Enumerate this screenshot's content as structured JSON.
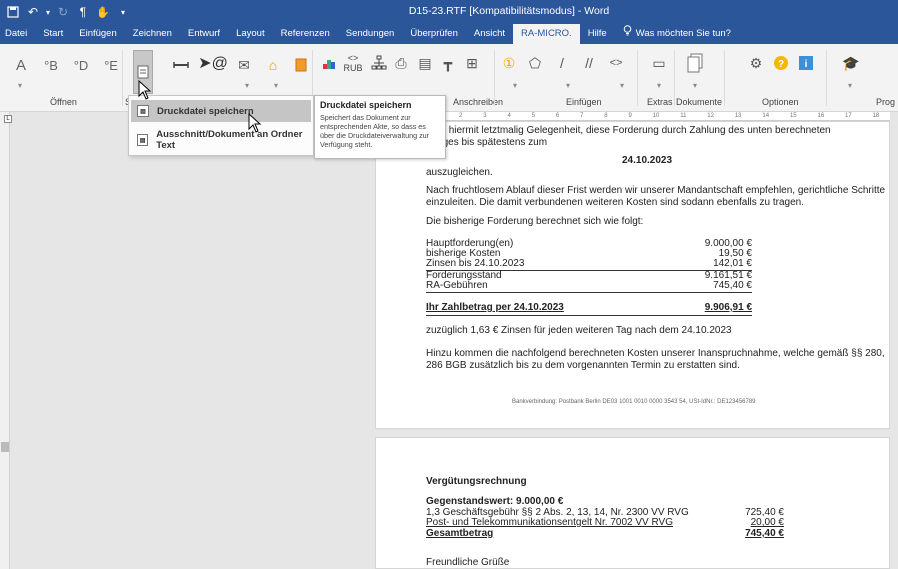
{
  "window": {
    "title": "D15-23.RTF [Kompatibilitätsmodus] - Word"
  },
  "tabs": [
    {
      "label": "Datei"
    },
    {
      "label": "Start"
    },
    {
      "label": "Einfügen"
    },
    {
      "label": "Zeichnen"
    },
    {
      "label": "Entwurf"
    },
    {
      "label": "Layout"
    },
    {
      "label": "Referenzen"
    },
    {
      "label": "Sendungen"
    },
    {
      "label": "Überprüfen"
    },
    {
      "label": "Ansicht"
    },
    {
      "label": "RA-MICRO."
    },
    {
      "label": "Hilfe"
    },
    {
      "label": "Was möchten Sie tun?"
    }
  ],
  "ribbon": {
    "groups": {
      "oeffnen": "Öffnen",
      "s": "S",
      "anschreiben": "Anschreiben",
      "einfuegen": "Einfügen",
      "extras": "Extras",
      "dokumente": "Dokumente",
      "optionen": "Optionen",
      "prog": "Prog"
    },
    "icon_labels": {
      "a": "A",
      "b": "°B",
      "d": "°D",
      "e": "°E",
      "rub": "RUB"
    }
  },
  "menu": {
    "items": [
      {
        "label": "Druckdatei speichern"
      },
      {
        "label": "Ausschnitt/Dokument an Ordner Text"
      }
    ]
  },
  "tooltip": {
    "title": "Druckdatei speichern",
    "body": "Speichert das Dokument zur entsprechenden Akte, so dass es über die Druckdateiverwaltung zur Verfügung steht."
  },
  "page1": {
    "line1": "r geben hiermit letztmalig Gelegenheit, diese Forderung durch Zahlung des unten berechneten",
    "line2": "hlbetrages bis spätestens zum",
    "date": "24.10.2023",
    "auszugleichen": "auszugleichen.",
    "para2": "Nach fruchtlosem Ablauf dieser Frist werden wir unserer Mandantschaft empfehlen, gerichtliche Schritte einzuleiten. Die damit verbundenen weiteren Kosten sind sodann ebenfalls zu tragen.",
    "para3": "Die bisherige Forderung berechnet sich wie folgt:",
    "rows": [
      {
        "label": "Hauptforderung(en)",
        "value": "9.000,00 €"
      },
      {
        "label": "bisherige Kosten",
        "value": "19,50 €"
      },
      {
        "label": "Zinsen bis 24.10.2023",
        "value": "142,01 €"
      },
      {
        "label": "Forderungsstand",
        "value": "9.161,51 €"
      },
      {
        "label": "RA-Gebühren",
        "value": "745,40 €"
      }
    ],
    "total_label": "Ihr Zahlbetrag per 24.10.2023",
    "total_value": "9.906,91 €",
    "zuzueglich": "zuzüglich 1,63 € Zinsen für jeden weiteren Tag nach dem 24.10.2023",
    "para4": "Hinzu kommen die nachfolgend berechneten Kosten unserer Inanspruchnahme, welche gemäß §§ 280, 286 BGB zusätzlich bis zu dem vorgenannten Termin zu erstatten sind.",
    "footer": "Bankverbindung: Postbank Berlin DE03 1001 0010 0000 3543 54,    USt-IdNr.: DE123456789"
  },
  "page2": {
    "heading": "Vergütungsrechnung",
    "gegenstandswert": "Gegenstandswert: 9.000,00 €",
    "rows": [
      {
        "label": "1,3 Geschäftsgebühr §§ 2 Abs. 2, 13, 14, Nr. 2300 VV RVG",
        "value": "725,40 €"
      },
      {
        "label": "Post- und Telekommunikationsentgelt Nr. 7002 VV RVG",
        "value": "20,00 €"
      }
    ],
    "total_label": "Gesamtbetrag",
    "total_value": "745,40 €",
    "closing": "Freundliche Grüße"
  },
  "colors": {
    "word_blue": "#2b579a",
    "ribbon_bg": "#f3f3f3"
  }
}
